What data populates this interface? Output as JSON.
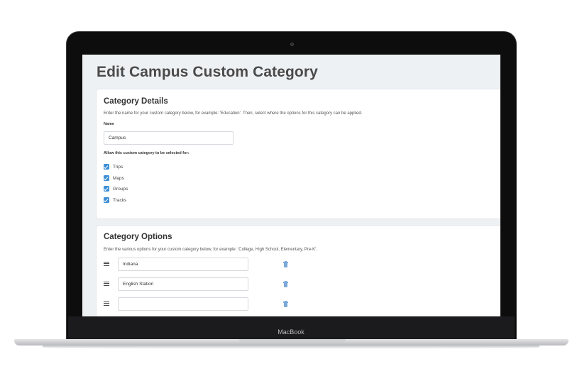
{
  "device": {
    "brand_label": "MacBook"
  },
  "page": {
    "title": "Edit Campus Custom Category"
  },
  "details": {
    "title": "Category Details",
    "description": "Enter the name for your custom category below, for example: 'Education'. Then, select where the options for this category can be applied.",
    "name_label": "Name",
    "name_value": "Campus",
    "allow_label": "Allow this custom category to be selected for:",
    "checkboxes": [
      {
        "label": "Trips",
        "checked": true
      },
      {
        "label": "Maps",
        "checked": true
      },
      {
        "label": "Groups",
        "checked": true
      },
      {
        "label": "Tracks",
        "checked": true
      }
    ]
  },
  "options": {
    "title": "Category Options",
    "description": "Enter the various options for your custom category below, for example: 'College, High School, Elementary, Pre-K'.",
    "items": [
      {
        "value": "Indiana"
      },
      {
        "value": "English Station"
      },
      {
        "value": ""
      }
    ]
  },
  "colors": {
    "accent": "#3d8fd6",
    "trash_icon": "#7aa8d8",
    "screen_bg": "#eef1f4"
  }
}
